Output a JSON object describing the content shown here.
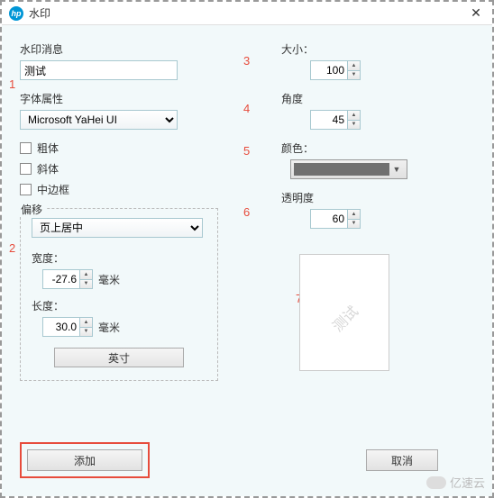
{
  "window": {
    "title": "水印",
    "close": "✕"
  },
  "numbers": {
    "n1": "1",
    "n2": "2",
    "n3": "3",
    "n4": "4",
    "n5": "5",
    "n6": "6",
    "n7": "7"
  },
  "msg": {
    "label": "水印消息",
    "value": "测试"
  },
  "font": {
    "label": "字体属性",
    "value": "Microsoft YaHei UI",
    "bold": "粗体",
    "italic": "斜体",
    "border": "中边框"
  },
  "offset": {
    "legend": "偏移",
    "position": "页上居中",
    "width_label": "宽度：",
    "width_value": "-27.6",
    "height_label": "长度：",
    "height_value": "30.0",
    "unit": "毫米",
    "inch_btn": "英寸"
  },
  "size": {
    "label": "大小：",
    "value": "100"
  },
  "angle": {
    "label": "角度",
    "value": "45"
  },
  "color": {
    "label": "颜色：",
    "value": "#707070"
  },
  "opacity": {
    "label": "透明度",
    "value": "60"
  },
  "preview": {
    "text": "测试"
  },
  "actions": {
    "add": "添加",
    "cancel": "取消"
  },
  "brand": "亿速云"
}
